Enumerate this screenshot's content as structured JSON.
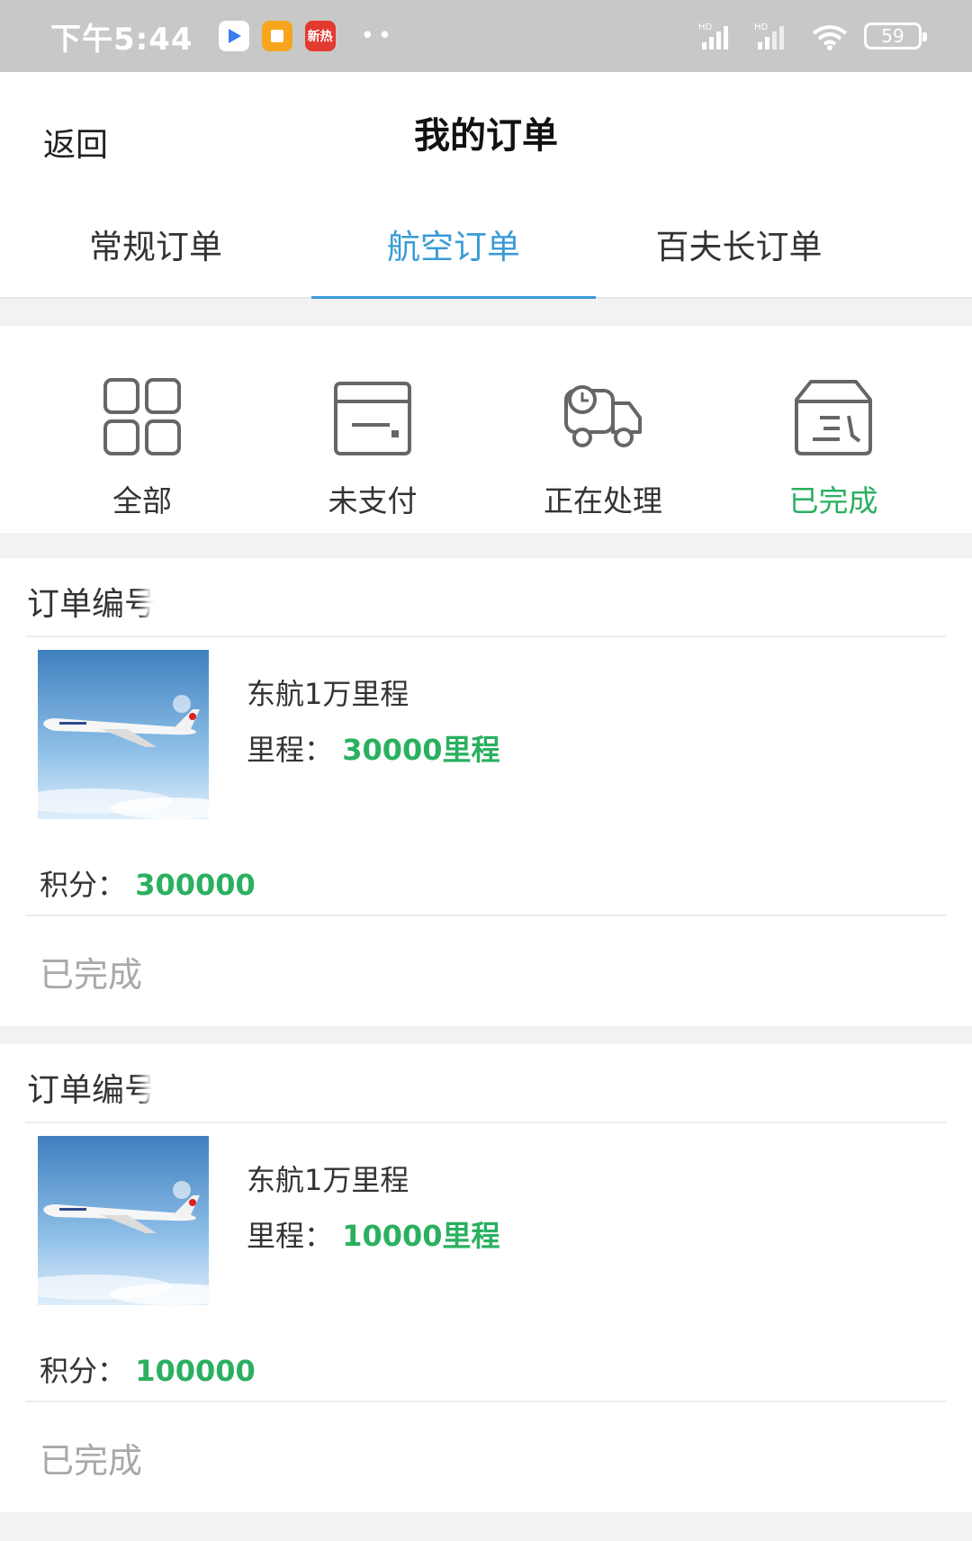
{
  "status_bar": {
    "time": "下午5:44",
    "news_icon_text": "新热",
    "battery": "59",
    "dots": "••"
  },
  "header": {
    "back_label": "返回",
    "title": "我的订单"
  },
  "tabs": [
    {
      "label": "常规订单",
      "active": false
    },
    {
      "label": "航空订单",
      "active": true
    },
    {
      "label": "百夫长订单",
      "active": false
    }
  ],
  "filters": [
    {
      "label": "全部",
      "icon": "grid-icon",
      "active": false
    },
    {
      "label": "未支付",
      "icon": "wallet-icon",
      "active": false
    },
    {
      "label": "正在处理",
      "icon": "truck-icon",
      "active": false
    },
    {
      "label": "已完成",
      "icon": "box-icon",
      "active": true
    }
  ],
  "labels": {
    "order_no": "订单编号",
    "mileage": "里程：",
    "points": "积分："
  },
  "orders": [
    {
      "product": "东航1万里程",
      "mileage_value": "30000里程",
      "points_value": "300000",
      "status": "已完成"
    },
    {
      "product": "东航1万里程",
      "mileage_value": "10000里程",
      "points_value": "100000",
      "status": "已完成"
    }
  ],
  "colors": {
    "accent_blue": "#3a9bd6",
    "accent_green": "#2ab060",
    "status_grey": "#a8a8a8"
  }
}
